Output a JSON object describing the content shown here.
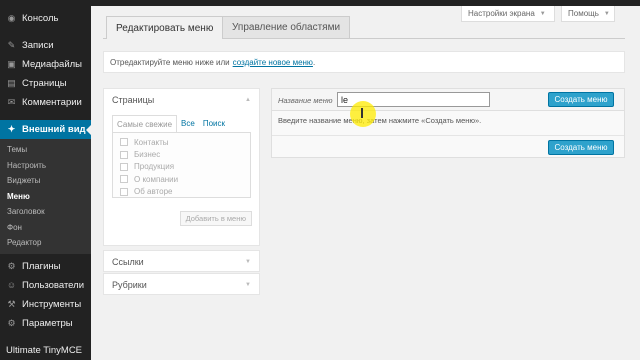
{
  "sidebar": {
    "items_top": [
      {
        "label": "Консоль",
        "icon": "dashboard-icon",
        "glyph": "◉"
      }
    ],
    "items_content": [
      {
        "label": "Записи",
        "icon": "pin-icon",
        "glyph": "✎"
      },
      {
        "label": "Медиафайлы",
        "icon": "media-icon",
        "glyph": "▣"
      },
      {
        "label": "Страницы",
        "icon": "page-icon",
        "glyph": "▤"
      },
      {
        "label": "Комментарии",
        "icon": "comment-icon",
        "glyph": "✉"
      }
    ],
    "active": {
      "label": "Внешний вид",
      "icon": "appearance-icon",
      "glyph": "✦"
    },
    "submenu": [
      "Темы",
      "Настроить",
      "Виджеты",
      "Меню",
      "Заголовок",
      "Фон",
      "Редактор"
    ],
    "submenu_current_index": 3,
    "items_bottom": [
      {
        "label": "Плагины",
        "icon": "plugin-icon",
        "glyph": "⚙"
      },
      {
        "label": "Пользователи",
        "icon": "users-icon",
        "glyph": "☺"
      },
      {
        "label": "Инструменты",
        "icon": "tools-icon",
        "glyph": "⚒"
      },
      {
        "label": "Параметры",
        "icon": "settings-icon",
        "glyph": "⚙"
      }
    ],
    "extra": "Ultimate TinyMCE"
  },
  "screen_options": {
    "label": "Настройки экрана"
  },
  "help": {
    "label": "Помощь"
  },
  "tabs": {
    "edit": "Редактировать меню",
    "locations": "Управление областями"
  },
  "info": {
    "text": "Отредактируйте меню ниже или",
    "link": "создайте новое меню",
    "suffix": "."
  },
  "pages_panel": {
    "title": "Страницы",
    "tabs": [
      "Самые свежие",
      "Все",
      "Поиск"
    ],
    "items": [
      "Контакты",
      "Бизнес",
      "Продукция",
      "О компании",
      "Об авторе"
    ],
    "add_button": "Добавить в меню"
  },
  "links_panel": {
    "title": "Ссылки"
  },
  "categories_panel": {
    "title": "Рубрики"
  },
  "editor": {
    "name_label": "Название меню",
    "name_value": "le",
    "create_top": "Создать меню",
    "hint": "Введите название меню, затем нажмите «Создать меню».",
    "create_bottom": "Создать меню"
  },
  "colors": {
    "accent": "#0074a2",
    "button": "#2ea2cc",
    "sidebar": "#222222"
  }
}
